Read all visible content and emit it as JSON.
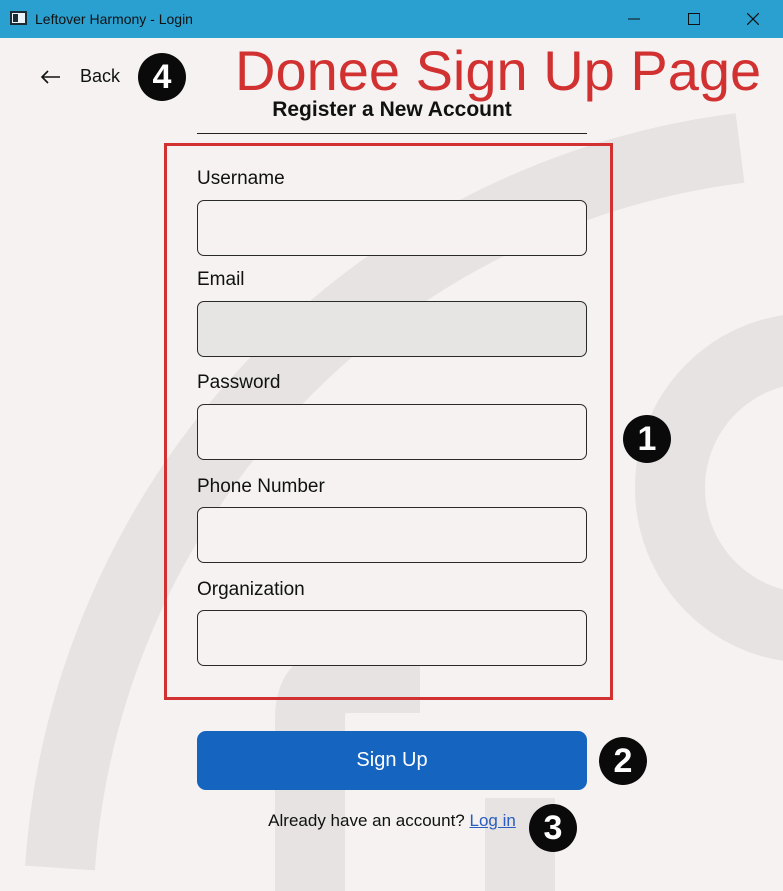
{
  "window": {
    "title": "Leftover Harmony - Login",
    "controls": [
      "minimize-icon",
      "maximize-icon",
      "close-icon"
    ]
  },
  "annotation": {
    "title": "Donee Sign Up Page",
    "title_color": "#d23131",
    "badges": [
      "1",
      "2",
      "3",
      "4"
    ]
  },
  "nav": {
    "back_label": "Back",
    "back_icon": "arrow-left-icon"
  },
  "form": {
    "heading": "Register a New Account",
    "fields": [
      {
        "label": "Username",
        "value": ""
      },
      {
        "label": "Email",
        "value": ""
      },
      {
        "label": "Password",
        "value": ""
      },
      {
        "label": "Phone Number",
        "value": ""
      },
      {
        "label": "Organization",
        "value": ""
      }
    ],
    "submit_label": "Sign Up",
    "login_prompt": "Already have an account?",
    "login_link": "Log in"
  },
  "colors": {
    "accent": "#1565c0",
    "titlebar": "#2aa0d0",
    "background": "#f5f2f1"
  }
}
